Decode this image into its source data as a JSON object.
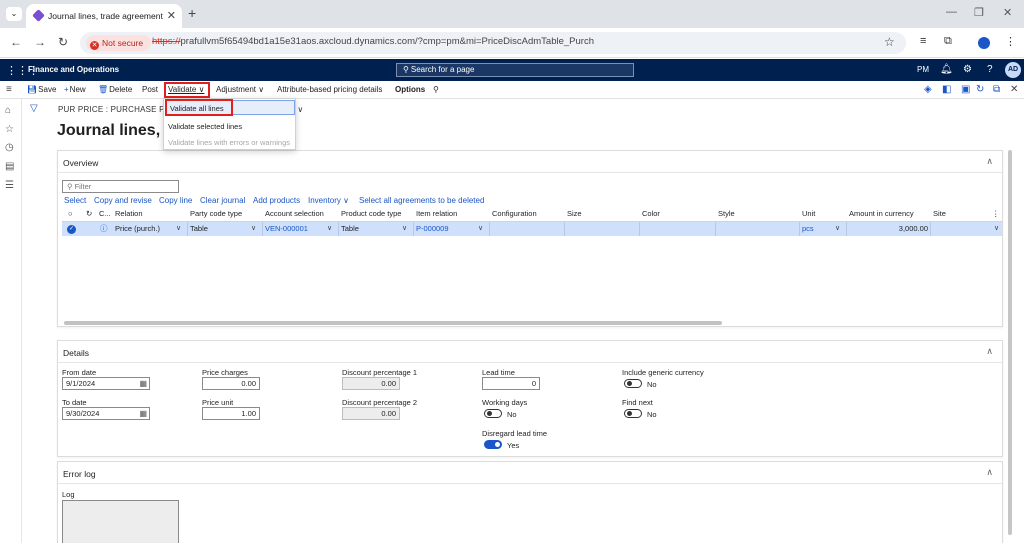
{
  "browser": {
    "tab_title": "Journal lines, trade agreement",
    "not_secure_label": "Not secure",
    "url_protocol": "https://",
    "url_rest": "prafullvm5f65494bd1a15e31aos.axcloud.dynamics.com/?cmp=pm&mi=PriceDiscAdmTable_Purch"
  },
  "app": {
    "name": "Finance and Operations",
    "search_placeholder": "Search for a page",
    "company": "PM",
    "user_initials": "AD"
  },
  "actions": {
    "save": "Save",
    "new": "New",
    "delete": "Delete",
    "post": "Post",
    "validate": "Validate",
    "adjustment": "Adjustment",
    "attribute_pricing": "Attribute-based pricing details",
    "options": "Options"
  },
  "validate_menu": {
    "items": [
      {
        "label": "Validate all lines"
      },
      {
        "label": "Validate selected lines"
      },
      {
        "label": "Validate lines with errors or warnings"
      }
    ]
  },
  "header": {
    "breadcrumb": "PUR PRICE : PURCHASE PRICE",
    "breadcrumb_tail": "* ∨",
    "title": "Journal lines, tra"
  },
  "overview": {
    "title": "Overview",
    "filter_placeholder": "Filter",
    "actions": [
      "Select",
      "Copy and revise",
      "Copy line",
      "Clear journal",
      "Add products",
      "Inventory",
      "Select all agreements to be deleted"
    ],
    "columns": [
      "C...",
      "Relation",
      "Party code type",
      "Account selection",
      "Product code type",
      "Item relation",
      "Configuration",
      "Size",
      "Color",
      "Style",
      "Unit",
      "Amount in currency",
      "Site"
    ],
    "row": {
      "relation": "Price (purch.)",
      "party_code_type": "Table",
      "account_selection": "VEN-000001",
      "product_code_type": "Table",
      "item_relation": "P-000009",
      "configuration": "",
      "size": "",
      "color": "",
      "style": "",
      "unit": "pcs",
      "amount": "3,000.00",
      "site": ""
    }
  },
  "details": {
    "title": "Details",
    "from_date_label": "From date",
    "from_date": "9/1/2024",
    "to_date_label": "To date",
    "to_date": "9/30/2024",
    "price_charges_label": "Price charges",
    "price_charges": "0.00",
    "price_unit_label": "Price unit",
    "price_unit": "1.00",
    "discount1_label": "Discount percentage 1",
    "discount1": "0.00",
    "discount2_label": "Discount percentage 2",
    "discount2": "0.00",
    "lead_time_label": "Lead time",
    "lead_time": "0",
    "working_days_label": "Working days",
    "working_days": "No",
    "disregard_lead_time_label": "Disregard lead time",
    "disregard_lead_time": "Yes",
    "include_generic_currency_label": "Include generic currency",
    "include_generic_currency": "No",
    "find_next_label": "Find next",
    "find_next": "No"
  },
  "error_log": {
    "title": "Error log",
    "log_label": "Log"
  },
  "colors": {
    "nav_bar": "#002050",
    "accent": "#1a56c7",
    "highlight_box": "#e0201b",
    "selected_row": "#cfe0fc"
  }
}
